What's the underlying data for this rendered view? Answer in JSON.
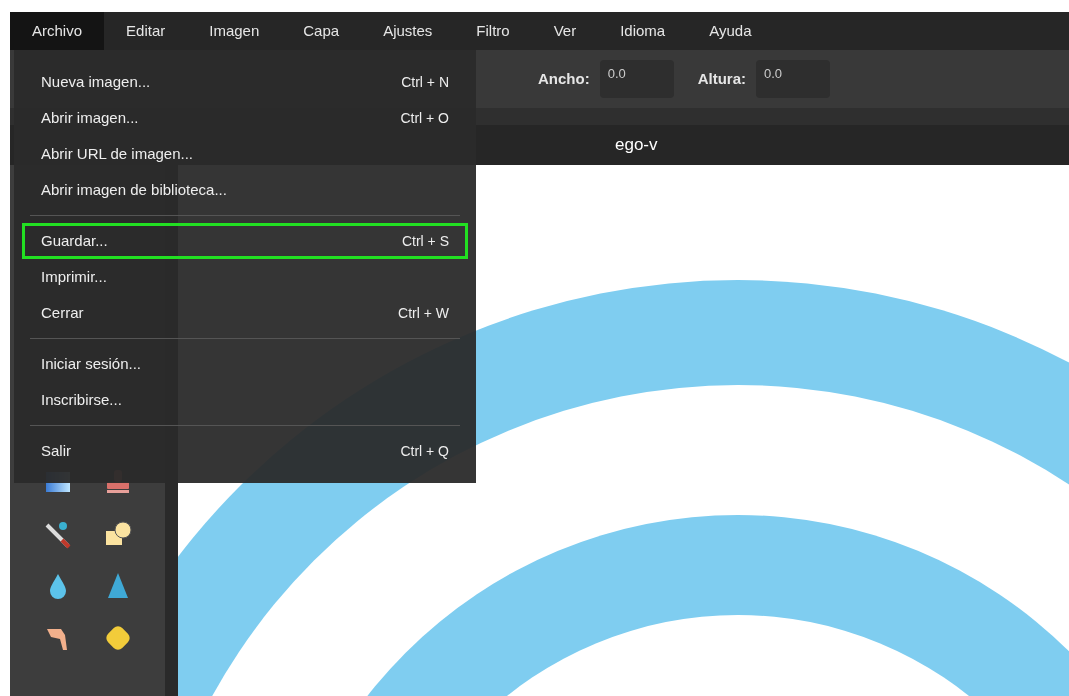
{
  "menubar": [
    {
      "label": "Archivo",
      "selected": true
    },
    {
      "label": "Editar",
      "selected": false
    },
    {
      "label": "Imagen",
      "selected": false
    },
    {
      "label": "Capa",
      "selected": false
    },
    {
      "label": "Ajustes",
      "selected": false
    },
    {
      "label": "Filtro",
      "selected": false
    },
    {
      "label": "Ver",
      "selected": false
    },
    {
      "label": "Idioma",
      "selected": false
    },
    {
      "label": "Ayuda",
      "selected": false
    }
  ],
  "toolbar": {
    "width_label": "Ancho:",
    "width_value": "0.0",
    "height_label": "Altura:",
    "height_value": "0.0"
  },
  "document_tab": {
    "title": "ego-v"
  },
  "file_menu": {
    "groups": [
      [
        {
          "label": "Nueva imagen...",
          "shortcut": "Ctrl + N",
          "highlighted": false
        },
        {
          "label": "Abrir imagen...",
          "shortcut": "Ctrl + O",
          "highlighted": false
        },
        {
          "label": "Abrir URL de imagen...",
          "highlighted": false
        },
        {
          "label": "Abrir imagen de biblioteca...",
          "highlighted": false
        }
      ],
      [
        {
          "label": "Guardar...",
          "shortcut": "Ctrl + S",
          "highlighted": true
        },
        {
          "label": "Imprimir...",
          "highlighted": false
        },
        {
          "label": "Cerrar",
          "shortcut": "Ctrl + W",
          "highlighted": false
        }
      ],
      [
        {
          "label": "Iniciar sesión...",
          "highlighted": false
        },
        {
          "label": "Inscribirse...",
          "highlighted": false
        }
      ],
      [
        {
          "label": "Salir",
          "shortcut": "Ctrl + Q",
          "highlighted": false
        }
      ]
    ]
  }
}
